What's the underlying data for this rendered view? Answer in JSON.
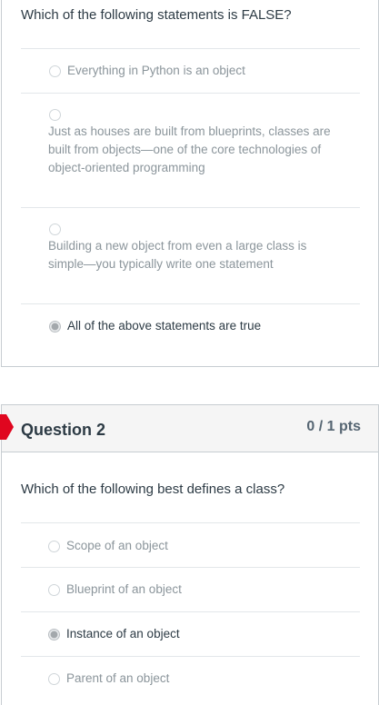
{
  "question1": {
    "prompt": "Which of the following statements is FALSE?",
    "answers": [
      {
        "text": "Everything in Python is an object",
        "selected": false
      },
      {
        "text": "Just as houses are built from blueprints, classes are built from objects—one of the core technologies of object-oriented programming",
        "selected": false
      },
      {
        "text": "Building a new object from even a large class is simple—you typically write one statement",
        "selected": false
      },
      {
        "text": "All of the above statements are true",
        "selected": true
      }
    ]
  },
  "question2": {
    "title": "Question 2",
    "points": "0 / 1 pts",
    "prompt": "Which of the following best defines a class?",
    "answers": [
      {
        "text": "Scope of an object",
        "selected": false
      },
      {
        "text": "Blueprint of an object",
        "selected": false
      },
      {
        "text": "Instance of an object",
        "selected": true
      },
      {
        "text": "Parent of an object",
        "selected": false
      }
    ]
  },
  "colors": {
    "flag": "#e0061f",
    "text": "#2d3b45",
    "muted": "#8b959b",
    "border": "#c7cdd1"
  }
}
